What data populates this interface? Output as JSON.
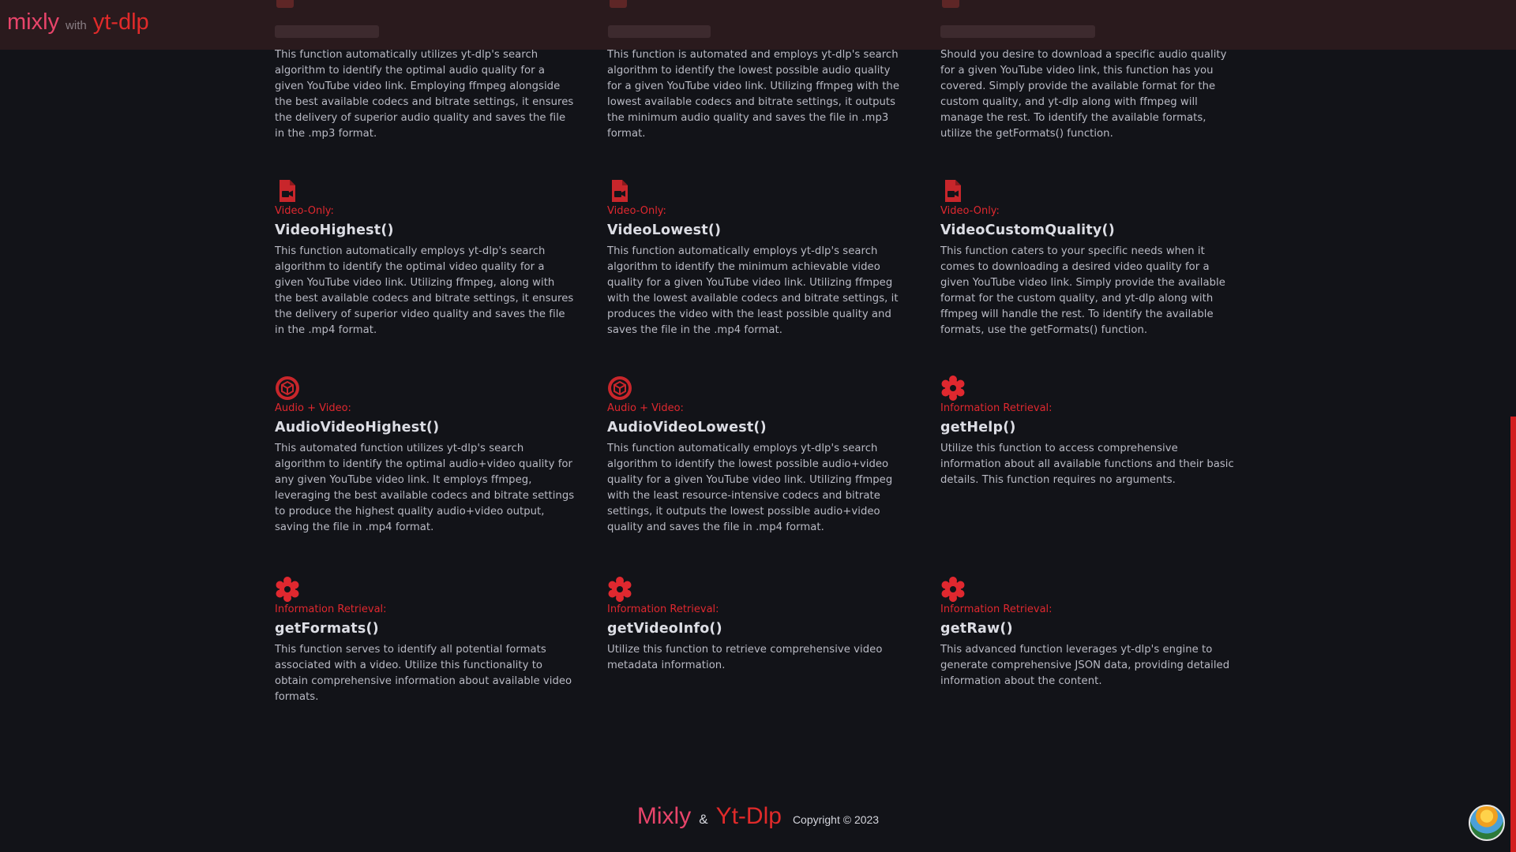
{
  "header": {
    "brand_part1": "mixly",
    "brand_part2": "with",
    "brand_part3": "yt-dlp"
  },
  "top_descriptions": [
    "This function automatically utilizes yt-dlp's search algorithm to identify the optimal audio quality for a given YouTube video link. Employing ffmpeg alongside the best available codecs and bitrate settings, it ensures the delivery of superior audio quality and saves the file in the .mp3 format.",
    "This function is automated and employs yt-dlp's search algorithm to identify the lowest possible audio quality for a given YouTube video link. Utilizing ffmpeg with the lowest available codecs and bitrate settings, it outputs the minimum audio quality and saves the file in .mp3 format.",
    "Should you desire to download a specific audio quality for a given YouTube video link, this function has you covered. Simply provide the available format for the custom quality, and yt-dlp along with ffmpeg will manage the rest. To identify the available formats, utilize the getFormats() function."
  ],
  "cards": [
    {
      "icon": "video-file-icon",
      "category": "Video-Only:",
      "name": "VideoHighest()",
      "desc": "This function automatically employs yt-dlp's search algorithm to identify the optimal video quality for a given YouTube video link. Utilizing ffmpeg, along with the best available codecs and bitrate settings, it ensures the delivery of superior video quality and saves the file in the .mp4 format."
    },
    {
      "icon": "video-file-icon",
      "category": "Video-Only:",
      "name": "VideoLowest()",
      "desc": "This function automatically employs yt-dlp's search algorithm to identify the minimum achievable video quality for a given YouTube video link. Utilizing ffmpeg with the lowest available codecs and bitrate settings, it produces the video with the least possible quality and saves the file in the .mp4 format."
    },
    {
      "icon": "video-file-icon",
      "category": "Video-Only:",
      "name": "VideoCustomQuality()",
      "desc": "This function caters to your specific needs when it comes to downloading a desired video quality for a given YouTube video link. Simply provide the available format for the custom quality, and yt-dlp along with ffmpeg will handle the rest. To identify the available formats, use the getFormats() function."
    },
    {
      "icon": "cube-icon",
      "category": "Audio + Video:",
      "name": "AudioVideoHighest()",
      "desc": "This automated function utilizes yt-dlp's search algorithm to identify the optimal audio+video quality for any given YouTube video link. It employs ffmpeg, leveraging the best available codecs and bitrate settings to produce the highest quality audio+video output, saving the file in .mp4 format."
    },
    {
      "icon": "cube-icon",
      "category": "Audio + Video:",
      "name": "AudioVideoLowest()",
      "desc": "This function automatically employs yt-dlp's search algorithm to identify the lowest possible audio+video quality for a given YouTube video link. Utilizing ffmpeg with the least resource-intensive codecs and bitrate settings, it outputs the lowest possible audio+video quality and saves the file in .mp4 format."
    },
    {
      "icon": "gear-icon",
      "category": "Information Retrieval:",
      "name": "getHelp()",
      "desc": "Utilize this function to access comprehensive information about all available functions and their basic details. This function requires no arguments."
    },
    {
      "icon": "gear-icon",
      "category": "Information Retrieval:",
      "name": "getFormats()",
      "desc": "This function serves to identify all potential formats associated with a video. Utilize this functionality to obtain comprehensive information about available video formats."
    },
    {
      "icon": "gear-icon",
      "category": "Information Retrieval:",
      "name": "getVideoInfo()",
      "desc": "Utilize this function to retrieve comprehensive video metadata information."
    },
    {
      "icon": "gear-icon",
      "category": "Information Retrieval:",
      "name": "getRaw()",
      "desc": "This advanced function leverages yt-dlp's engine to generate comprehensive JSON data, providing detailed information about the content."
    }
  ],
  "footer": {
    "part1": "Mixly",
    "part2": "&",
    "part3": "Yt-Dlp",
    "copyright": "Copyright © 2023"
  },
  "colors": {
    "accent_red": "#e0282f",
    "brand_pink": "#e8446a",
    "background": "#121318",
    "header_bg": "#2a1a1d"
  }
}
